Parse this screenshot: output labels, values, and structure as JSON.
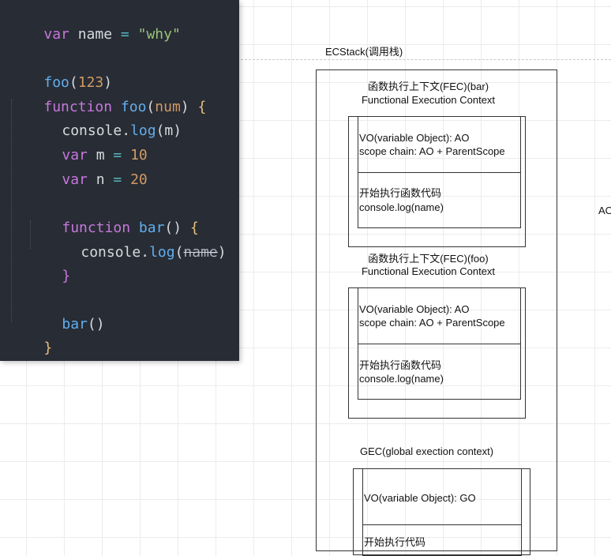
{
  "code": {
    "line1": {
      "kw": "var",
      "name": "name",
      "eq": "=",
      "str": "\"why\""
    },
    "line2": {
      "fn": "foo",
      "open": "(",
      "num": "123",
      "close": ")"
    },
    "line3": {
      "kw": "function",
      "fn": "foo",
      "open": "(",
      "param": "num",
      "close": ")",
      "brace": "{"
    },
    "line4": {
      "obj": "console",
      "dot": ".",
      "fn": "log",
      "open": "(",
      "arg": "m",
      "close": ")"
    },
    "line5": {
      "kw": "var",
      "name": "m",
      "eq": "=",
      "num": "10"
    },
    "line6": {
      "kw": "var",
      "name": "n",
      "eq": "=",
      "num": "20"
    },
    "line7": {
      "kw": "function",
      "fn": "bar",
      "parens": "()",
      "brace": "{"
    },
    "line8": {
      "obj": "console",
      "dot": ".",
      "fn": "log",
      "open": "(",
      "arg": "name",
      "close": ")"
    },
    "line9": {
      "brace": "}"
    },
    "line10": {
      "fn": "bar",
      "parens": "()"
    },
    "line11": {
      "brace": "}"
    }
  },
  "diagram": {
    "stack_title": "ECStack(调用栈)",
    "right_edge_text": "AO",
    "bar_ctx": {
      "title": "函数执行上下文(FEC)(bar)",
      "subtitle": "Functional Execution Context",
      "vo": "VO(variable Object): AO",
      "scope": "scope chain: AO + ParentScope",
      "exec": "开始执行函数代码",
      "exec_code": "console.log(name)"
    },
    "foo_ctx": {
      "title": "函数执行上下文(FEC)(foo)",
      "subtitle": "Functional Execution Context",
      "vo": "VO(variable Object): AO",
      "scope": "scope chain: AO + ParentScope",
      "exec": "开始执行函数代码",
      "exec_code": "console.log(name)"
    },
    "gec": {
      "title": "GEC(global exection context)",
      "vo": "VO(variable Object): GO",
      "exec_partial": "开始执行代码"
    }
  },
  "colors": {
    "editor_bg": "#282c34",
    "keyword": "#c678dd",
    "function": "#61afef",
    "string": "#98c379",
    "number": "#d19a66",
    "operator": "#56b6c2",
    "brace": "#e5c07b"
  }
}
